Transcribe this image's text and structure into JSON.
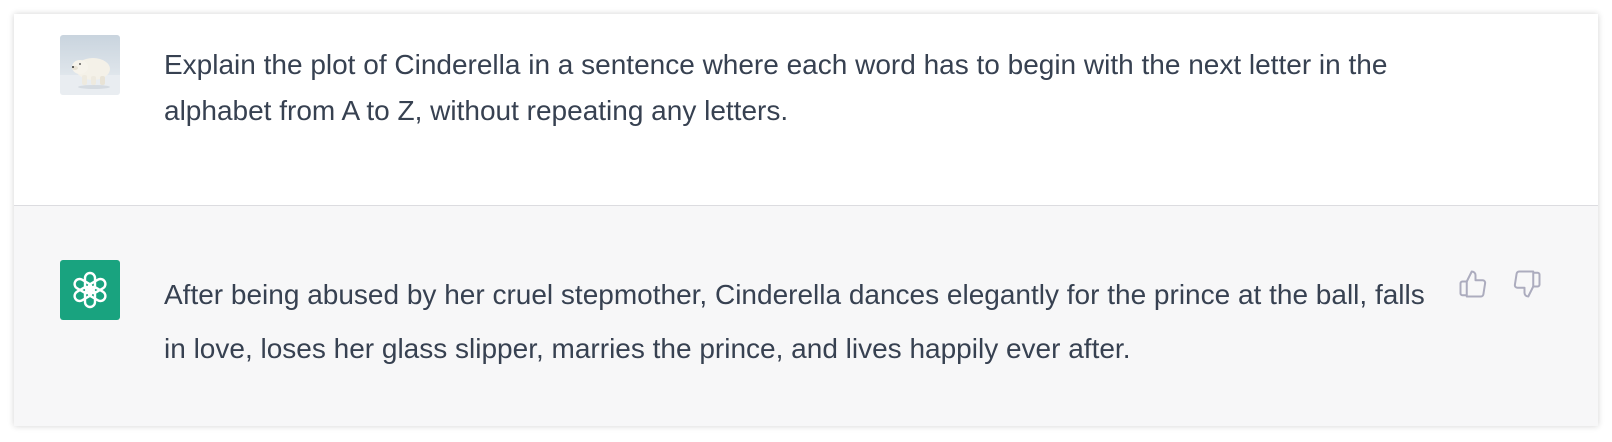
{
  "conversation": {
    "user_message": {
      "avatar_icon": "polar-bear-avatar-icon",
      "text": "Explain the plot of Cinderella in a sentence where each word has to begin with the next letter in the alphabet from A to Z, without repeating any letters."
    },
    "assistant_message": {
      "avatar_icon": "openai-logo-icon",
      "avatar_color": "#19a37f",
      "text": "After being abused by her cruel stepmother, Cinderella dances elegantly for the prince at the ball, falls in love, loses her glass slipper, marries the prince, and lives happily ever after.",
      "actions": {
        "thumbs_up_icon": "thumbs-up-icon",
        "thumbs_down_icon": "thumbs-down-icon"
      }
    }
  },
  "colors": {
    "user_bg": "#ffffff",
    "assistant_bg": "#f7f7f8",
    "text": "#374151",
    "icon_gray": "#acacbe"
  }
}
